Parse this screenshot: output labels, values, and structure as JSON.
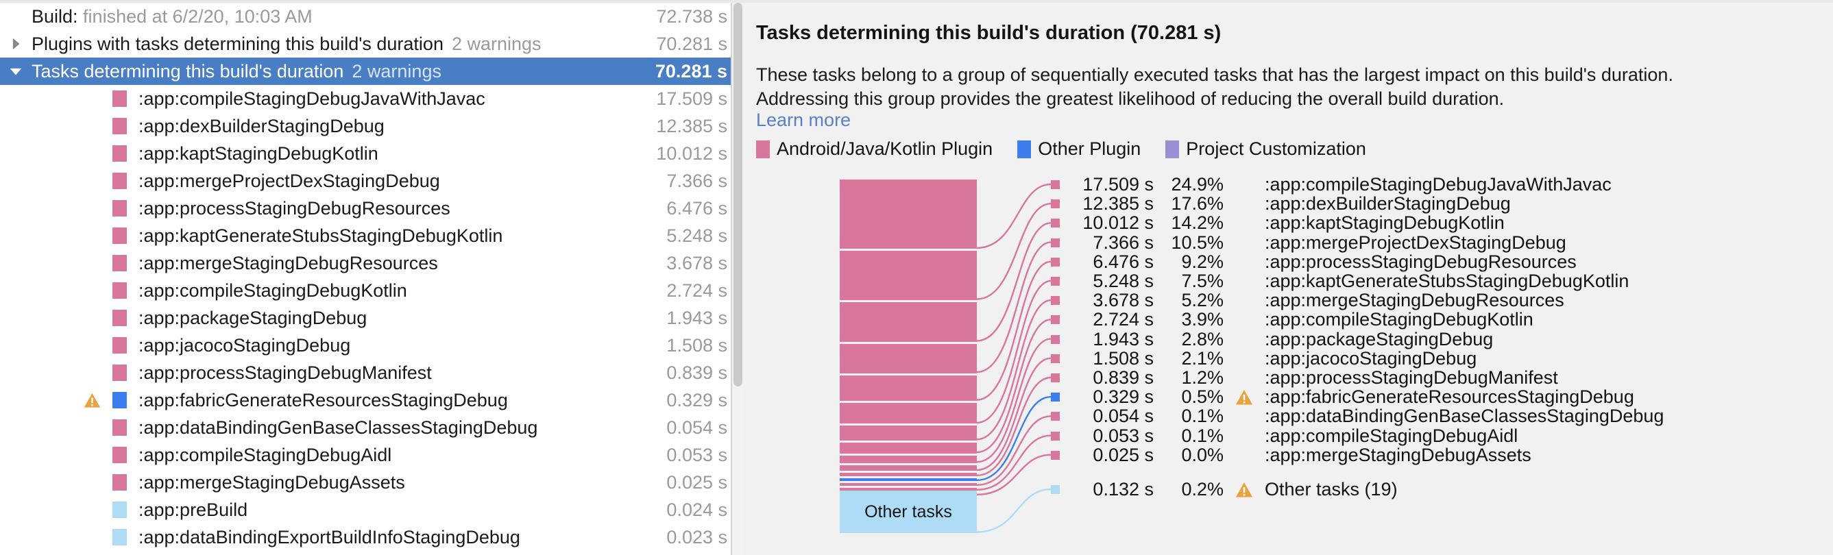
{
  "colors": {
    "plugin_pink": "#d8769c",
    "other_plugin_blue": "#3d7eee",
    "project_customization_purple": "#9b8fd4",
    "other_tasks_light_blue": "#aedcf7",
    "selection_blue": "#4a7ec4",
    "link_blue": "#5a7fc4",
    "warning_amber": "#e8a33d",
    "panel_background": "#f1f1f1",
    "muted_text": "#9a9a9a"
  },
  "tree": {
    "rows": [
      {
        "indent": 0,
        "twisty": "none",
        "swatch": null,
        "warning": false,
        "label_bold": "Build:",
        "label_muted": " finished at 6/2/20, 10:03 AM",
        "warnings": "",
        "duration": "72.738 s",
        "selected": false
      },
      {
        "indent": 0,
        "twisty": "collapsed",
        "swatch": null,
        "warning": false,
        "label_bold": "",
        "label_muted": "",
        "label": "Plugins with tasks determining this build's duration",
        "warnings": "2 warnings",
        "duration": "70.281 s",
        "selected": false
      },
      {
        "indent": 0,
        "twisty": "expanded",
        "swatch": null,
        "warning": false,
        "label": "Tasks determining this build's duration",
        "warnings": "2 warnings",
        "duration": "70.281 s",
        "selected": true
      },
      {
        "indent": 2,
        "twisty": "none",
        "swatch": "pink",
        "warning": false,
        "label": ":app:compileStagingDebugJavaWithJavac",
        "warnings": "",
        "duration": "17.509 s",
        "selected": false
      },
      {
        "indent": 2,
        "twisty": "none",
        "swatch": "pink",
        "warning": false,
        "label": ":app:dexBuilderStagingDebug",
        "warnings": "",
        "duration": "12.385 s",
        "selected": false
      },
      {
        "indent": 2,
        "twisty": "none",
        "swatch": "pink",
        "warning": false,
        "label": ":app:kaptStagingDebugKotlin",
        "warnings": "",
        "duration": "10.012 s",
        "selected": false
      },
      {
        "indent": 2,
        "twisty": "none",
        "swatch": "pink",
        "warning": false,
        "label": ":app:mergeProjectDexStagingDebug",
        "warnings": "",
        "duration": "7.366 s",
        "selected": false
      },
      {
        "indent": 2,
        "twisty": "none",
        "swatch": "pink",
        "warning": false,
        "label": ":app:processStagingDebugResources",
        "warnings": "",
        "duration": "6.476 s",
        "selected": false
      },
      {
        "indent": 2,
        "twisty": "none",
        "swatch": "pink",
        "warning": false,
        "label": ":app:kaptGenerateStubsStagingDebugKotlin",
        "warnings": "",
        "duration": "5.248 s",
        "selected": false
      },
      {
        "indent": 2,
        "twisty": "none",
        "swatch": "pink",
        "warning": false,
        "label": ":app:mergeStagingDebugResources",
        "warnings": "",
        "duration": "3.678 s",
        "selected": false
      },
      {
        "indent": 2,
        "twisty": "none",
        "swatch": "pink",
        "warning": false,
        "label": ":app:compileStagingDebugKotlin",
        "warnings": "",
        "duration": "2.724 s",
        "selected": false
      },
      {
        "indent": 2,
        "twisty": "none",
        "swatch": "pink",
        "warning": false,
        "label": ":app:packageStagingDebug",
        "warnings": "",
        "duration": "1.943 s",
        "selected": false
      },
      {
        "indent": 2,
        "twisty": "none",
        "swatch": "pink",
        "warning": false,
        "label": ":app:jacocoStagingDebug",
        "warnings": "",
        "duration": "1.508 s",
        "selected": false
      },
      {
        "indent": 2,
        "twisty": "none",
        "swatch": "pink",
        "warning": false,
        "label": ":app:processStagingDebugManifest",
        "warnings": "",
        "duration": "0.839 s",
        "selected": false
      },
      {
        "indent": 2,
        "twisty": "none",
        "swatch": "blue",
        "warning": true,
        "label": ":app:fabricGenerateResourcesStagingDebug",
        "warnings": "",
        "duration": "0.329 s",
        "selected": false
      },
      {
        "indent": 2,
        "twisty": "none",
        "swatch": "pink",
        "warning": false,
        "label": ":app:dataBindingGenBaseClassesStagingDebug",
        "warnings": "",
        "duration": "0.054 s",
        "selected": false
      },
      {
        "indent": 2,
        "twisty": "none",
        "swatch": "pink",
        "warning": false,
        "label": ":app:compileStagingDebugAidl",
        "warnings": "",
        "duration": "0.053 s",
        "selected": false
      },
      {
        "indent": 2,
        "twisty": "none",
        "swatch": "pink",
        "warning": false,
        "label": ":app:mergeStagingDebugAssets",
        "warnings": "",
        "duration": "0.025 s",
        "selected": false
      },
      {
        "indent": 2,
        "twisty": "none",
        "swatch": "lightblue",
        "warning": false,
        "label": ":app:preBuild",
        "warnings": "",
        "duration": "0.024 s",
        "selected": false
      },
      {
        "indent": 2,
        "twisty": "none",
        "swatch": "lightblue",
        "warning": false,
        "label": ":app:dataBindingExportBuildInfoStagingDebug",
        "warnings": "",
        "duration": "0.023 s",
        "selected": false
      }
    ]
  },
  "detail": {
    "title": "Tasks determining this build's duration (70.281 s)",
    "description_line1": "These tasks belong to a group of sequentially executed tasks that has the largest impact on this build's duration.",
    "description_line2": "Addressing this group provides the greatest likelihood of reducing the overall build duration.",
    "learn_more": "Learn more",
    "legend": [
      {
        "label": "Android/Java/Kotlin Plugin",
        "color": "#d8769c"
      },
      {
        "label": "Other Plugin",
        "color": "#3d7eee"
      },
      {
        "label": "Project Customization",
        "color": "#9b8fd4"
      }
    ],
    "other_tasks_bar_label": "Other tasks"
  },
  "chart_data": {
    "type": "bar",
    "title": "Tasks determining this build's duration (70.281 s)",
    "subtitle": "Stacked bar of task durations with callout labels",
    "total_seconds": 70.281,
    "unit": "s",
    "legend_position": "top",
    "grid": false,
    "categories": [
      ":app:compileStagingDebugJavaWithJavac",
      ":app:dexBuilderStagingDebug",
      ":app:kaptStagingDebugKotlin",
      ":app:mergeProjectDexStagingDebug",
      ":app:processStagingDebugResources",
      ":app:kaptGenerateStubsStagingDebugKotlin",
      ":app:mergeStagingDebugResources",
      ":app:compileStagingDebugKotlin",
      ":app:packageStagingDebug",
      ":app:jacocoStagingDebug",
      ":app:processStagingDebugManifest",
      ":app:fabricGenerateResourcesStagingDebug",
      ":app:dataBindingGenBaseClassesStagingDebug",
      ":app:compileStagingDebugAidl",
      ":app:mergeStagingDebugAssets",
      "Other tasks (19)"
    ],
    "values": [
      17.509,
      12.385,
      10.012,
      7.366,
      6.476,
      5.248,
      3.678,
      2.724,
      1.943,
      1.508,
      0.839,
      0.329,
      0.054,
      0.053,
      0.025,
      0.132
    ],
    "percents": [
      "24.9%",
      "17.6%",
      "14.2%",
      "10.5%",
      "9.2%",
      "7.5%",
      "5.2%",
      "3.9%",
      "2.8%",
      "2.1%",
      "1.2%",
      "0.5%",
      "0.1%",
      "0.1%",
      "0.0%",
      "0.2%"
    ],
    "durations": [
      "17.509 s",
      "12.385 s",
      "10.012 s",
      "7.366 s",
      "6.476 s",
      "5.248 s",
      "3.678 s",
      "2.724 s",
      "1.943 s",
      "1.508 s",
      "0.839 s",
      "0.329 s",
      "0.054 s",
      "0.053 s",
      "0.025 s",
      "0.132 s"
    ],
    "series_colors": [
      "#d8769c",
      "#d8769c",
      "#d8769c",
      "#d8769c",
      "#d8769c",
      "#d8769c",
      "#d8769c",
      "#d8769c",
      "#d8769c",
      "#d8769c",
      "#d8769c",
      "#3d7eee",
      "#d8769c",
      "#d8769c",
      "#d8769c",
      "#aedcf7"
    ],
    "warnings": [
      false,
      false,
      false,
      false,
      false,
      false,
      false,
      false,
      false,
      false,
      false,
      true,
      false,
      false,
      false,
      true
    ],
    "series": [
      {
        "name": "Android/Java/Kotlin Plugin",
        "color": "#d8769c"
      },
      {
        "name": "Other Plugin",
        "color": "#3d7eee"
      },
      {
        "name": "Project Customization",
        "color": "#9b8fd4"
      }
    ]
  }
}
